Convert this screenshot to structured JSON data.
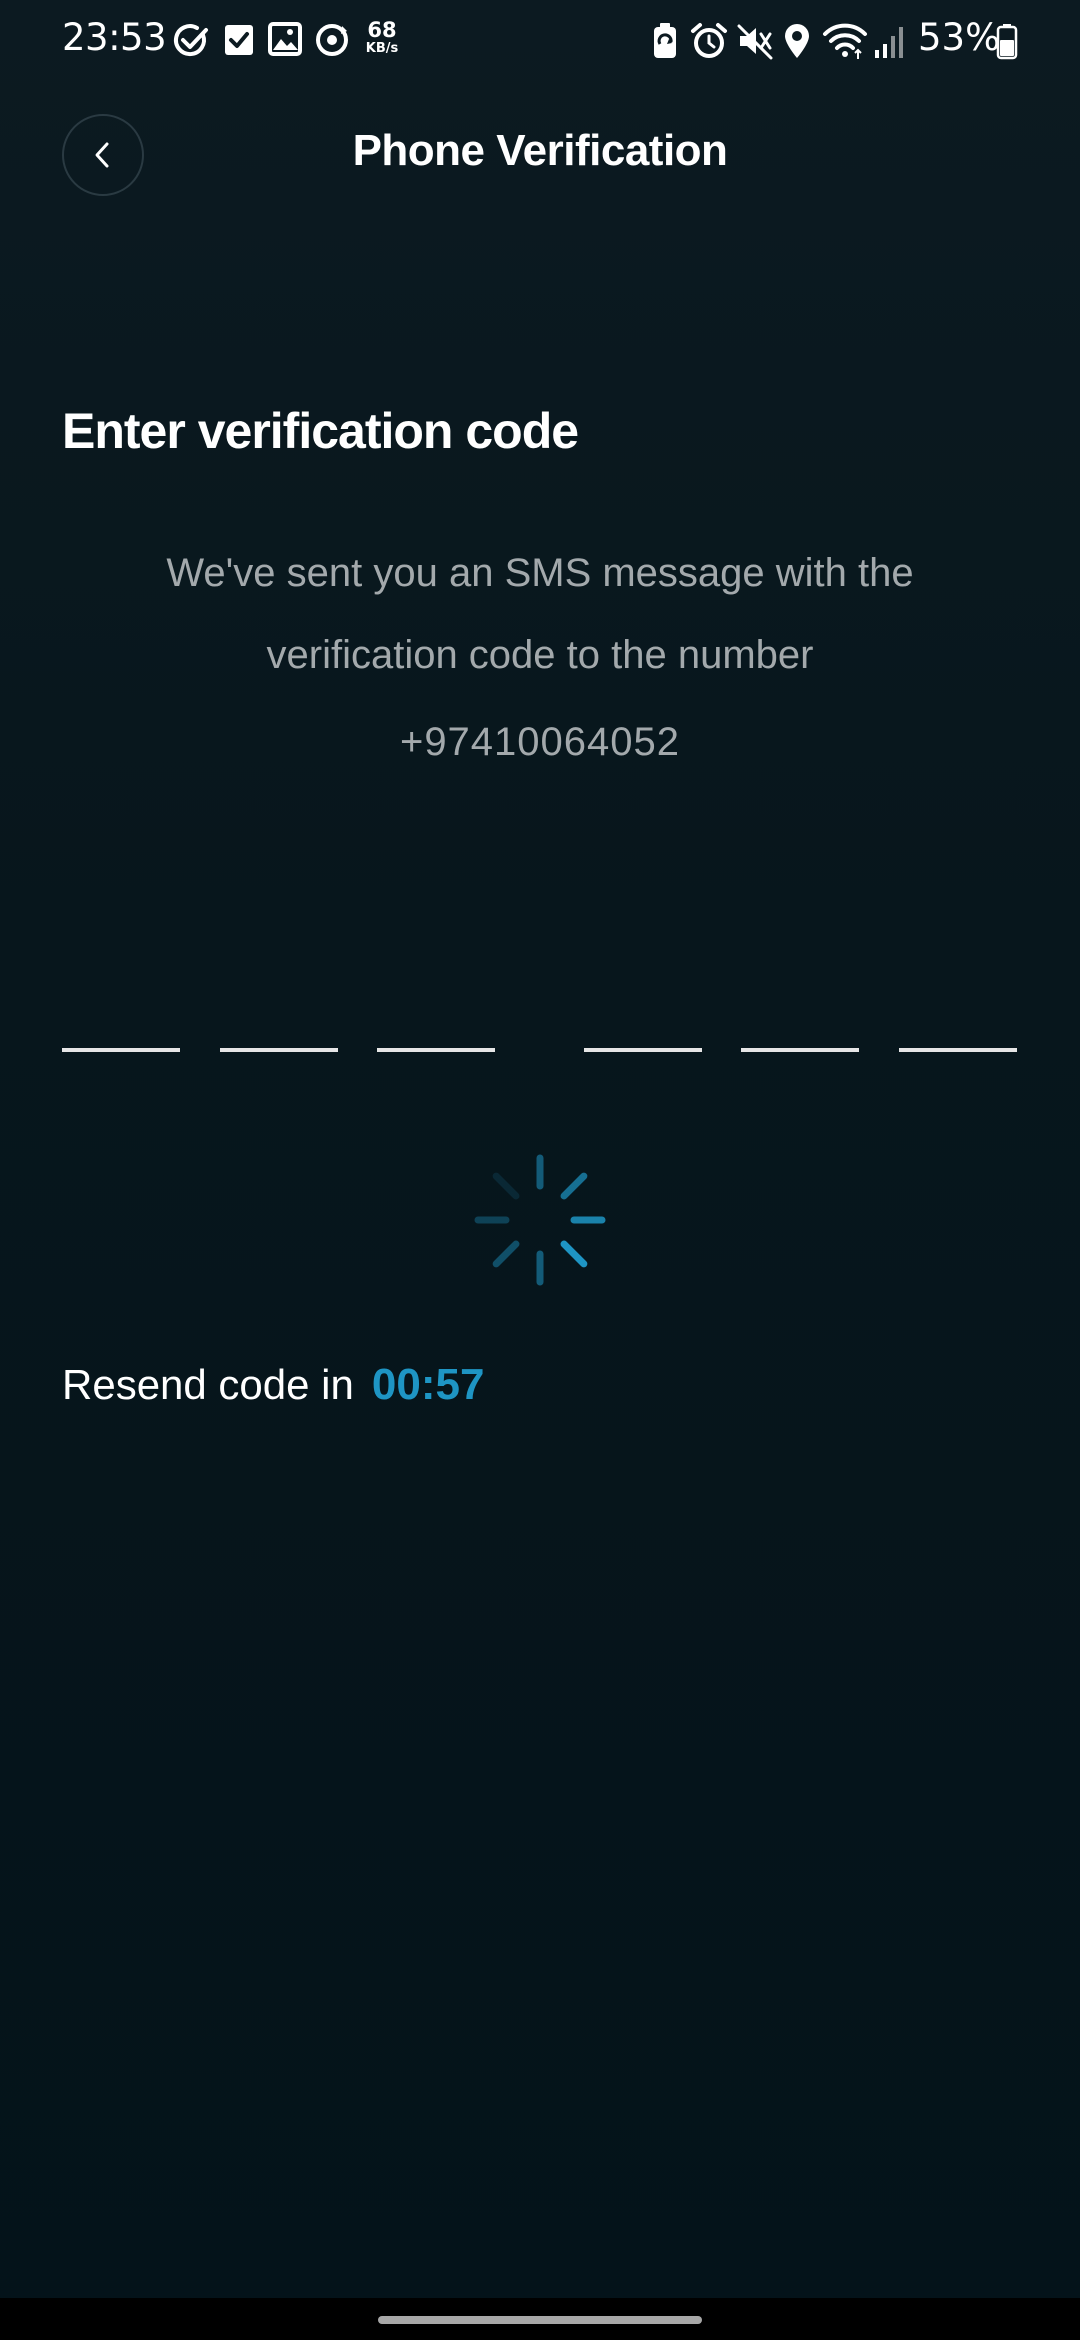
{
  "status_bar": {
    "time": "23:53",
    "net_speed_value": "68",
    "net_speed_unit": "KB/s",
    "battery_percent": "53%",
    "left_icons": [
      "check-circle-icon",
      "checkbox-icon",
      "gallery-icon",
      "sync-icon"
    ],
    "right_icons": [
      "battery-saver-icon",
      "alarm-icon",
      "mute-vibrate-icon",
      "location-icon",
      "wifi-icon",
      "signal-icon",
      "battery-icon"
    ]
  },
  "header": {
    "title": "Phone Verification",
    "back_icon": "chevron-left-icon"
  },
  "verification": {
    "heading": "Enter verification code",
    "message": "We've sent you an SMS message with the verification code to the number",
    "phone_number": "+97410064052",
    "code_length": 6,
    "digits": [
      "",
      "",
      "",
      "",
      "",
      ""
    ]
  },
  "loading": {
    "icon": "loading-spinner-icon"
  },
  "resend": {
    "label": "Resend code in",
    "countdown": "00:57"
  },
  "colors": {
    "background": "#07161c",
    "accent": "#1e95c4",
    "text_secondary": "#a3a9ac",
    "input_line": "#e6e6e6"
  }
}
